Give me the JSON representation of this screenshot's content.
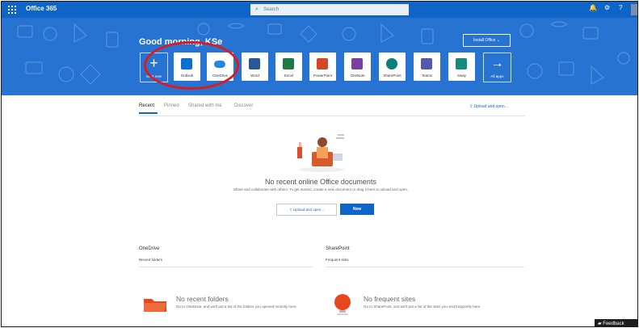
{
  "suite": {
    "title": "Office 365",
    "search_placeholder": "Search"
  },
  "hero": {
    "greeting": "Good morning, KSe",
    "install_label": "Install Office",
    "apps": [
      {
        "name": "Start new",
        "color": ""
      },
      {
        "name": "Outlook",
        "color": "#0a6fd1"
      },
      {
        "name": "OneDrive",
        "color": "#1e88e5"
      },
      {
        "name": "Word",
        "color": "#2b5797"
      },
      {
        "name": "Excel",
        "color": "#1d7a44"
      },
      {
        "name": "PowerPoint",
        "color": "#d24726"
      },
      {
        "name": "OneNote",
        "color": "#7b3fa3"
      },
      {
        "name": "SharePoint",
        "color": "#0b7f7a"
      },
      {
        "name": "Teams",
        "color": "#5558af"
      },
      {
        "name": "Sway",
        "color": "#158a7a"
      },
      {
        "name": "All apps",
        "color": ""
      }
    ]
  },
  "tabs": [
    "Recent",
    "Pinned",
    "Shared with me",
    "Discover"
  ],
  "upload_label": "Upload and open...",
  "empty_state": {
    "title": "No recent online Office documents",
    "subtitle": "Share and collaborate with others. To get started, create a new document or drag it here to upload and open.",
    "upload_button": "Upload and open...",
    "new_button": "New"
  },
  "onedrive": {
    "title": "OneDrive",
    "subtitle": "Recent folders",
    "empty_title": "No recent folders",
    "empty_text": "Go to OneDrive, and we'll put a list of the folders you opened recently here."
  },
  "sharepoint": {
    "title": "SharePoint",
    "subtitle": "Frequent sites",
    "empty_title": "No frequent sites",
    "empty_text": "Go to SharePoint, and we'll put a list of the sites you visit frequently here."
  },
  "feedback_label": "Feedback",
  "colors": {
    "suitebar": "#0f64c8",
    "hero": "#2773d2",
    "callout": "#e0191e",
    "accent": "#1769c8"
  }
}
